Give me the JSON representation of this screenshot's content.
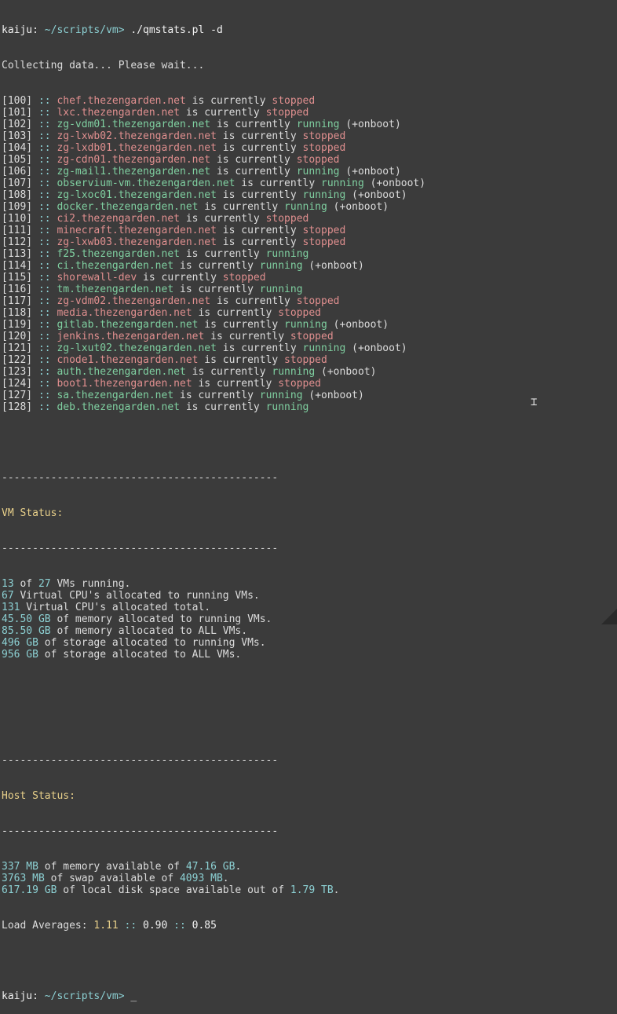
{
  "prompt": {
    "host": "kaiju:",
    "path": "~/scripts/vm>",
    "command": "./qmstats.pl -d"
  },
  "collecting": "Collecting data... Please wait...",
  "vms": [
    {
      "id": "[100]",
      "name": "chef.thezengarden.net",
      "state": "stopped",
      "onboot": ""
    },
    {
      "id": "[101]",
      "name": "lxc.thezengarden.net",
      "state": "stopped",
      "onboot": ""
    },
    {
      "id": "[102]",
      "name": "zg-vdm01.thezengarden.net",
      "state": "running",
      "onboot": "(+onboot)"
    },
    {
      "id": "[103]",
      "name": "zg-lxwb02.thezengarden.net",
      "state": "stopped",
      "onboot": ""
    },
    {
      "id": "[104]",
      "name": "zg-lxdb01.thezengarden.net",
      "state": "stopped",
      "onboot": ""
    },
    {
      "id": "[105]",
      "name": "zg-cdn01.thezengarden.net",
      "state": "stopped",
      "onboot": ""
    },
    {
      "id": "[106]",
      "name": "zg-mail1.thezengarden.net",
      "state": "running",
      "onboot": "(+onboot)"
    },
    {
      "id": "[107]",
      "name": "observium-vm.thezengarden.net",
      "state": "running",
      "onboot": "(+onboot)"
    },
    {
      "id": "[108]",
      "name": "zg-lxoc01.thezengarden.net",
      "state": "running",
      "onboot": "(+onboot)"
    },
    {
      "id": "[109]",
      "name": "docker.thezengarden.net",
      "state": "running",
      "onboot": "(+onboot)"
    },
    {
      "id": "[110]",
      "name": "ci2.thezengarden.net",
      "state": "stopped",
      "onboot": ""
    },
    {
      "id": "[111]",
      "name": "minecraft.thezengarden.net",
      "state": "stopped",
      "onboot": ""
    },
    {
      "id": "[112]",
      "name": "zg-lxwb03.thezengarden.net",
      "state": "stopped",
      "onboot": ""
    },
    {
      "id": "[113]",
      "name": "f25.thezengarden.net",
      "state": "running",
      "onboot": ""
    },
    {
      "id": "[114]",
      "name": "ci.thezengarden.net",
      "state": "running",
      "onboot": "(+onboot)"
    },
    {
      "id": "[115]",
      "name": "shorewall-dev",
      "state": "stopped",
      "onboot": ""
    },
    {
      "id": "[116]",
      "name": "tm.thezengarden.net",
      "state": "running",
      "onboot": ""
    },
    {
      "id": "[117]",
      "name": "zg-vdm02.thezengarden.net",
      "state": "stopped",
      "onboot": ""
    },
    {
      "id": "[118]",
      "name": "media.thezengarden.net",
      "state": "stopped",
      "onboot": ""
    },
    {
      "id": "[119]",
      "name": "gitlab.thezengarden.net",
      "state": "running",
      "onboot": "(+onboot)"
    },
    {
      "id": "[120]",
      "name": "jenkins.thezengarden.net",
      "state": "stopped",
      "onboot": ""
    },
    {
      "id": "[121]",
      "name": "zg-lxut02.thezengarden.net",
      "state": "running",
      "onboot": "(+onboot)"
    },
    {
      "id": "[122]",
      "name": "cnode1.thezengarden.net",
      "state": "stopped",
      "onboot": ""
    },
    {
      "id": "[123]",
      "name": "auth.thezengarden.net",
      "state": "running",
      "onboot": "(+onboot)"
    },
    {
      "id": "[124]",
      "name": "boot1.thezengarden.net",
      "state": "stopped",
      "onboot": ""
    },
    {
      "id": "[127]",
      "name": "sa.thezengarden.net",
      "state": "running",
      "onboot": "(+onboot)"
    },
    {
      "id": "[128]",
      "name": "deb.thezengarden.net",
      "state": "running",
      "onboot": ""
    }
  ],
  "vm_line": {
    "sep": " :: ",
    "mid": " is currently "
  },
  "separator": "---------------------------------------------",
  "vm_status": {
    "title": "VM Status:",
    "lines": [
      {
        "a": "13",
        "b": " of ",
        "c": "27",
        "d": " VMs running."
      },
      {
        "a": "67",
        "b": " Virtual CPU's allocated to running VMs.",
        "c": "",
        "d": ""
      },
      {
        "a": "131",
        "b": " Virtual CPU's allocated total.",
        "c": "",
        "d": ""
      },
      {
        "a": "45.50 GB",
        "b": " of memory allocated to running VMs.",
        "c": "",
        "d": ""
      },
      {
        "a": "85.50 GB",
        "b": " of memory allocated to ALL VMs.",
        "c": "",
        "d": ""
      },
      {
        "a": "496 GB",
        "b": " of storage allocated to running VMs.",
        "c": "",
        "d": ""
      },
      {
        "a": "956 GB",
        "b": " of storage allocated to ALL VMs.",
        "c": "",
        "d": ""
      }
    ]
  },
  "host_status": {
    "title": "Host Status:",
    "lines": [
      {
        "a": "337 MB",
        "b": " of memory available of ",
        "c": "47.16 GB",
        "d": "."
      },
      {
        "a": "3763 MB",
        "b": " of swap available of ",
        "c": "4093 MB",
        "d": "."
      },
      {
        "a": "617.19 GB",
        "b": " of local disk space available out of ",
        "c": "1.79 TB",
        "d": "."
      }
    ],
    "load_label": "Load Averages: ",
    "load": [
      "1.11",
      "0.90",
      "0.85"
    ],
    "load_sep": " :: "
  },
  "cursor": "_",
  "colors": {
    "background": "#3b3b3b",
    "running": "#7fcfa0",
    "stopped": "#e08f8f",
    "cyan": "#8cd0d3",
    "yellow": "#e8d08a"
  }
}
